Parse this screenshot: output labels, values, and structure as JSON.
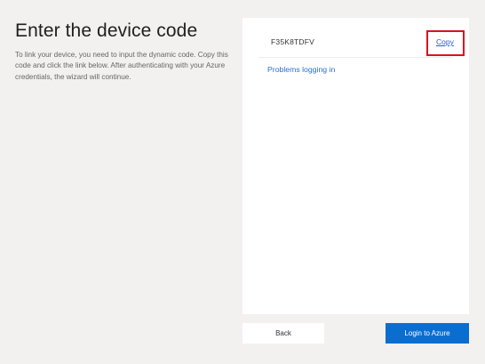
{
  "header": {
    "title": "Enter the device code",
    "instructions": "To link your device, you need to input the dynamic code. Copy this code and click the link below. After authenticating with your Azure credentials, the wizard will continue."
  },
  "code_panel": {
    "device_code": "F35K8TDFV",
    "copy_label": "Copy",
    "problems_label": "Problems logging in",
    "highlight_color": "#d9131b"
  },
  "footer": {
    "back_label": "Back",
    "login_label": "Login to Azure",
    "login_color": "#0a6ed1"
  }
}
